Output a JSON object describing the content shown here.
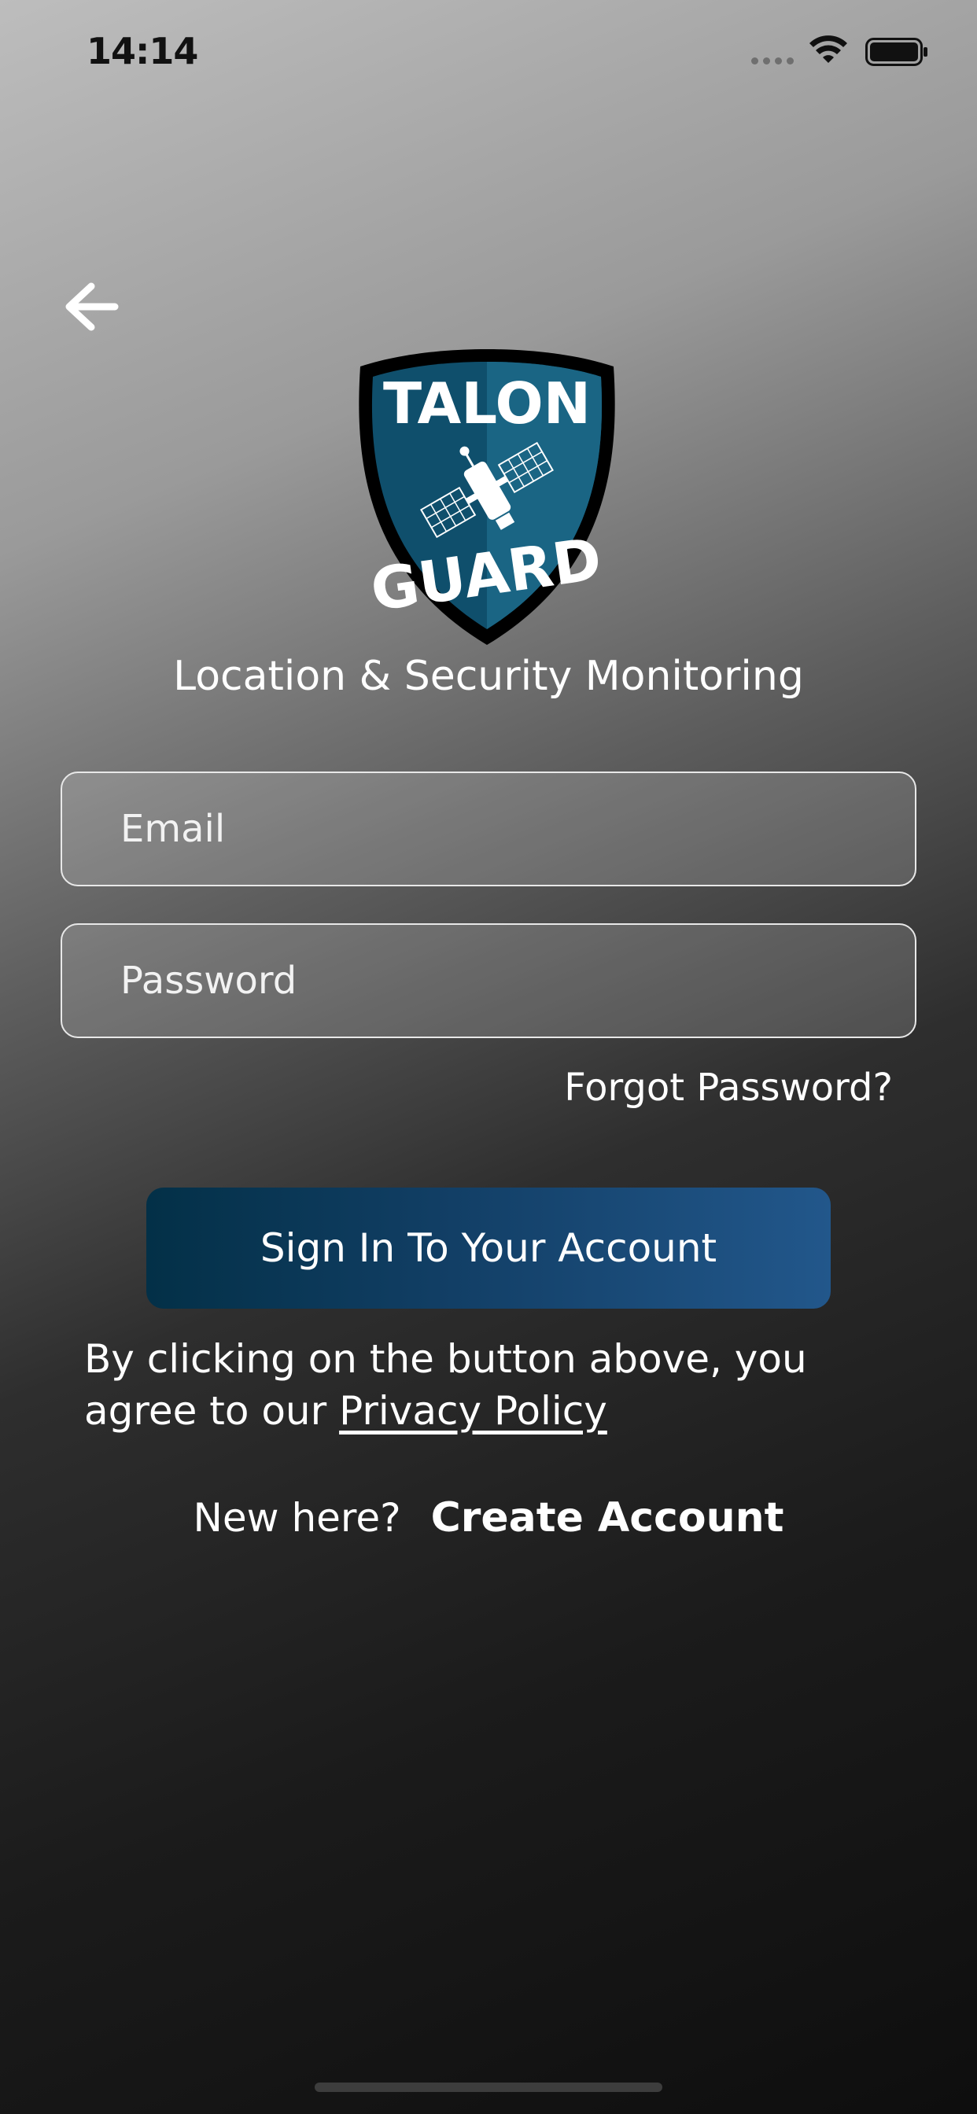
{
  "status_bar": {
    "time": "14:14"
  },
  "logo": {
    "line1": "TALON",
    "line2": "GUARD"
  },
  "tagline": "Location & Security Monitoring",
  "form": {
    "email_placeholder": "Email",
    "password_placeholder": "Password",
    "forgot_label": "Forgot Password?",
    "signin_label": "Sign In To Your Account"
  },
  "agreement": {
    "text": "By clicking on the button above, you agree to our ",
    "link_label": "Privacy Policy"
  },
  "signup": {
    "prompt": "New here?",
    "link_label": "Create Account"
  },
  "colors": {
    "button_start": "#033047",
    "button_end": "#22578b",
    "shield": "#135a78"
  }
}
